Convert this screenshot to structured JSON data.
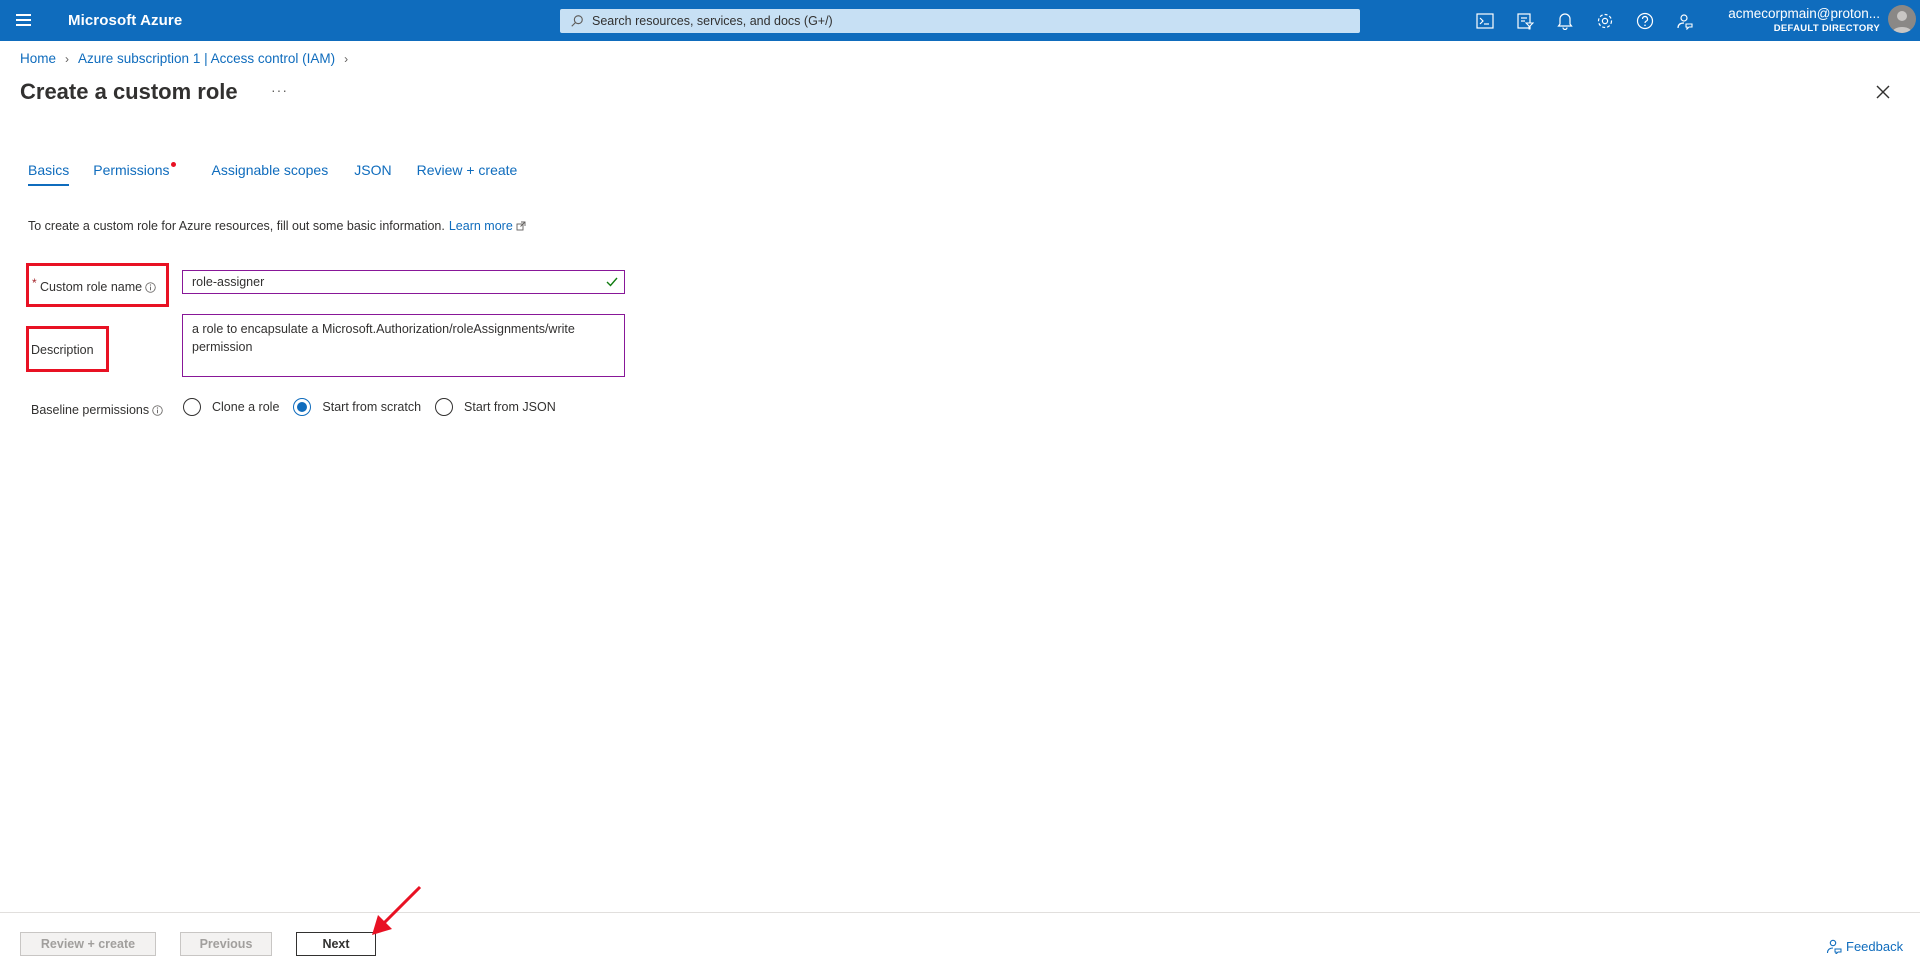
{
  "topbar": {
    "brand": "Microsoft Azure",
    "search_placeholder": "Search resources, services, and docs (G+/)",
    "icons": [
      "cloud-shell-icon",
      "directory-filter-icon",
      "notifications-icon",
      "settings-icon",
      "help-icon",
      "feedback-icon"
    ],
    "account_name": "acmecorpmain@proton...",
    "account_directory": "DEFAULT DIRECTORY"
  },
  "breadcrumb": {
    "home": "Home",
    "iam": "Azure subscription 1 | Access control (IAM)"
  },
  "page": {
    "title": "Create a custom role",
    "more": "···"
  },
  "tabs": [
    {
      "label": "Basics",
      "active": true
    },
    {
      "label": "Permissions",
      "has_error_dot": true
    },
    {
      "label": "Assignable scopes"
    },
    {
      "label": "JSON"
    },
    {
      "label": "Review + create"
    }
  ],
  "intro": {
    "text": "To create a custom role for Azure resources, fill out some basic information.",
    "link": "Learn more"
  },
  "form": {
    "role_name_label": "Custom role name",
    "role_name_value": "role-assigner",
    "description_label": "Description",
    "description_value": "a role to encapsulate a Microsoft.Authorization/roleAssignments/write permission",
    "baseline_label": "Baseline permissions",
    "baseline_options": [
      {
        "label": "Clone a role",
        "selected": false
      },
      {
        "label": "Start from scratch",
        "selected": true
      },
      {
        "label": "Start from JSON",
        "selected": false
      }
    ]
  },
  "footer": {
    "review_create": "Review + create",
    "previous": "Previous",
    "next": "Next",
    "feedback": "Feedback"
  },
  "colors": {
    "azure_blue": "#0f6cbd",
    "annotation_red": "#e81123",
    "field_border": "#881798"
  }
}
